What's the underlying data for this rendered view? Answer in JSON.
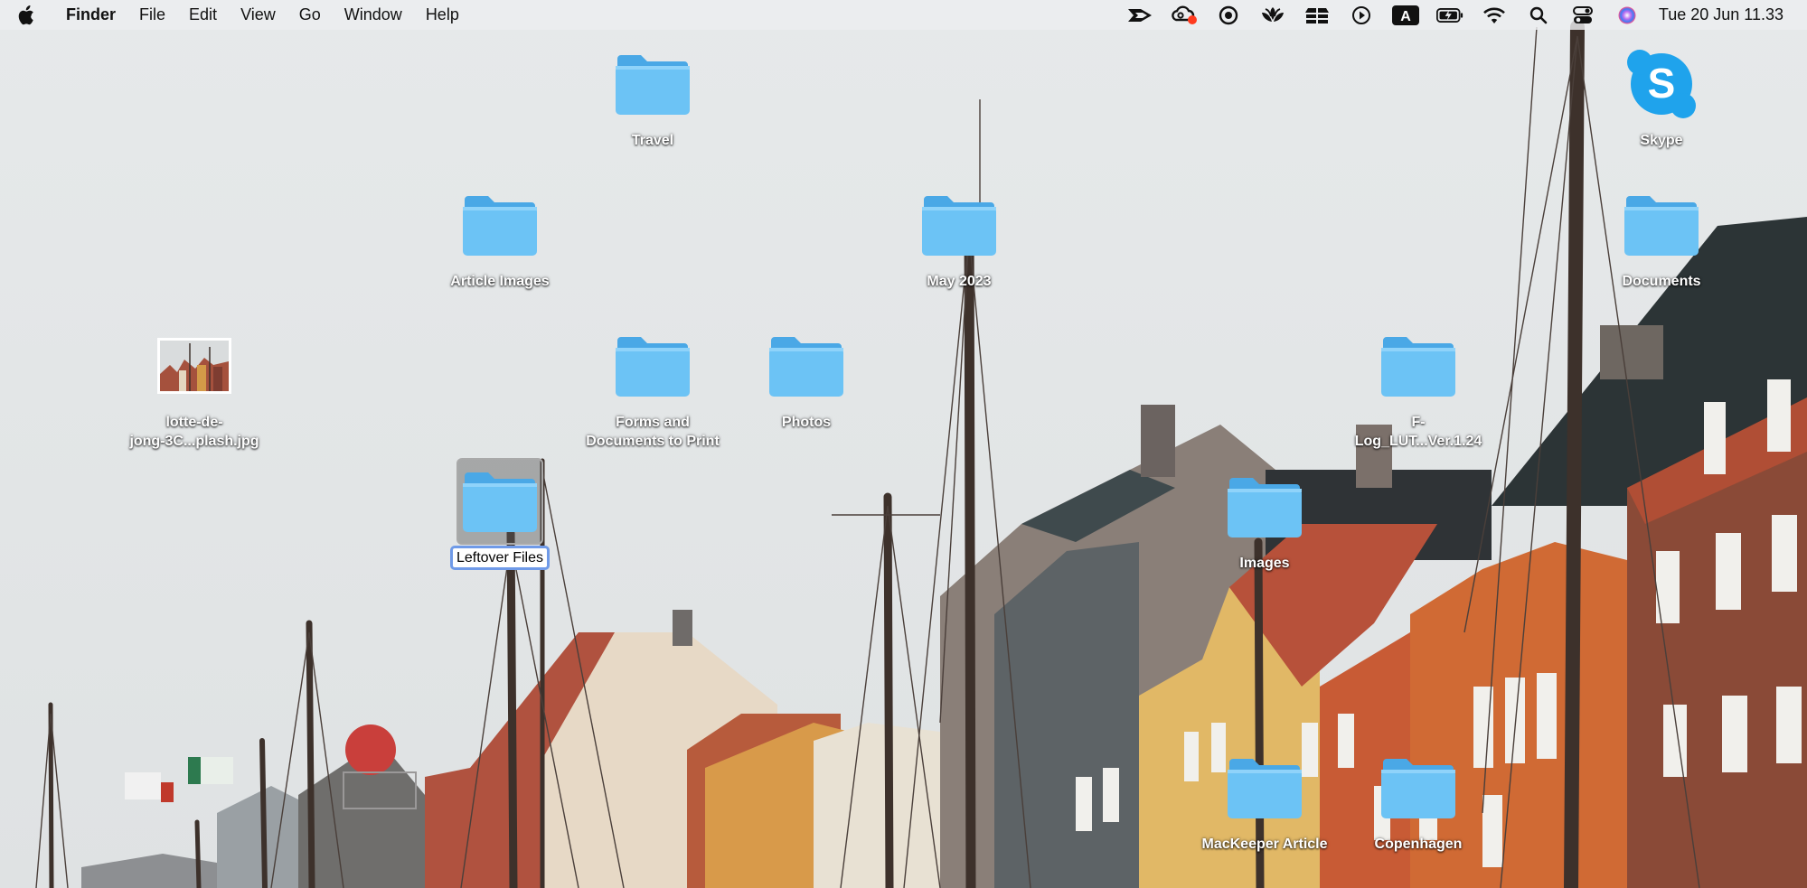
{
  "menubar": {
    "app_name": "Finder",
    "menus": [
      "File",
      "Edit",
      "View",
      "Go",
      "Window",
      "Help"
    ],
    "tray_icons": [
      "arrow-app-icon",
      "creative-cloud-icon",
      "sync-icon",
      "lotus-icon",
      "stack-icon",
      "play-circle-icon",
      "input-source-icon",
      "battery-icon",
      "wifi-icon",
      "search-icon",
      "control-center-icon",
      "siri-icon"
    ],
    "input_source_letter": "A",
    "clock": "Tue 20 Jun  11.33"
  },
  "desktop": {
    "icons": [
      {
        "id": "travel",
        "label": "Travel",
        "type": "folder"
      },
      {
        "id": "skype",
        "label": "Skype",
        "type": "app"
      },
      {
        "id": "article-images",
        "label": "Article Images",
        "type": "folder"
      },
      {
        "id": "may-2023",
        "label": "May 2023",
        "type": "folder"
      },
      {
        "id": "documents",
        "label": "Documents",
        "type": "folder"
      },
      {
        "id": "lotte-jpg",
        "label_line1": "lotte-de-",
        "label_line2": "jong-3C...plash.jpg",
        "type": "image"
      },
      {
        "id": "forms",
        "label_line1": "Forms and",
        "label_line2": "Documents to Print",
        "type": "folder"
      },
      {
        "id": "photos",
        "label": "Photos",
        "type": "folder"
      },
      {
        "id": "f-log",
        "label_line1": "F-",
        "label_line2": "Log_LUT...Ver.1.24",
        "type": "folder"
      },
      {
        "id": "leftover",
        "label": "Leftover Files",
        "type": "folder",
        "selected": true
      },
      {
        "id": "images",
        "label": "Images",
        "type": "folder"
      },
      {
        "id": "mackeeper",
        "label": "MacKeeper Article",
        "type": "folder"
      },
      {
        "id": "copenhagen",
        "label": "Copenhagen",
        "type": "folder"
      }
    ]
  },
  "colors": {
    "folder_body": "#6cc3f5",
    "folder_tab": "#4aa8e6",
    "selection_outline": "#6f9ae8",
    "skype_blue": "#1fa3ec"
  }
}
